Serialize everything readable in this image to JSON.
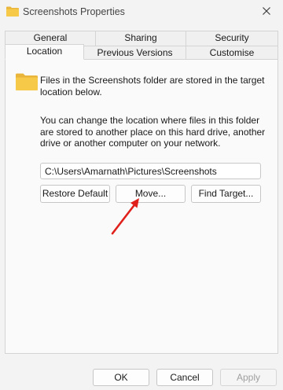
{
  "window": {
    "title": "Screenshots Properties",
    "close_icon": "close-icon"
  },
  "tabs": {
    "row1": [
      "General",
      "Sharing",
      "Security"
    ],
    "row2": [
      "Location",
      "Previous Versions",
      "Customise"
    ],
    "active": "Location"
  },
  "location": {
    "folder_icon": "folder-icon",
    "info": "Files in the Screenshots folder are stored in the target location below.",
    "description": "You can change the location where files in this folder are stored to another place on this hard drive, another drive or another computer on your network.",
    "path_value": "C:\\Users\\Amarnath\\Pictures\\Screenshots",
    "restore_default_label": "Restore Default",
    "move_label": "Move...",
    "find_target_label": "Find Target..."
  },
  "annotation": {
    "arrow_color": "#e0201b"
  },
  "footer": {
    "ok_label": "OK",
    "cancel_label": "Cancel",
    "apply_label": "Apply",
    "apply_enabled": false
  },
  "colors": {
    "folder": "#f7c948",
    "folder_dark": "#e9b53a",
    "panel_bg": "#fafafa",
    "window_bg": "#f3f3f3"
  }
}
